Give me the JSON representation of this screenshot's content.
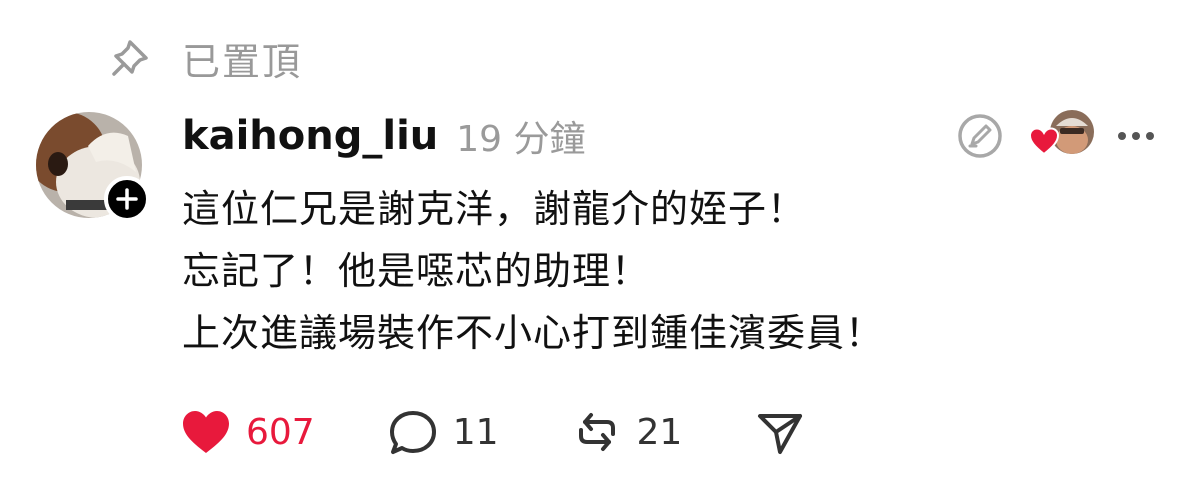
{
  "pinned": {
    "label": "已置頂"
  },
  "post": {
    "username": "kaihong_liu",
    "time": "19 分鐘",
    "lines": [
      "這位仁兄是謝克洋，謝龍介的姪子！",
      "忘記了！他是噁芯的助理！",
      "上次進議場裝作不小心打到鍾佳濱委員！"
    ]
  },
  "actions": {
    "likes": "607",
    "comments": "11",
    "reposts": "21"
  },
  "colors": {
    "like": "#e8193c",
    "muted": "#9a9a9a"
  },
  "icons": [
    "pin-icon",
    "follow-plus-icon",
    "edit-icon",
    "heart-icon",
    "more-icon",
    "comment-icon",
    "repost-icon",
    "share-icon"
  ]
}
